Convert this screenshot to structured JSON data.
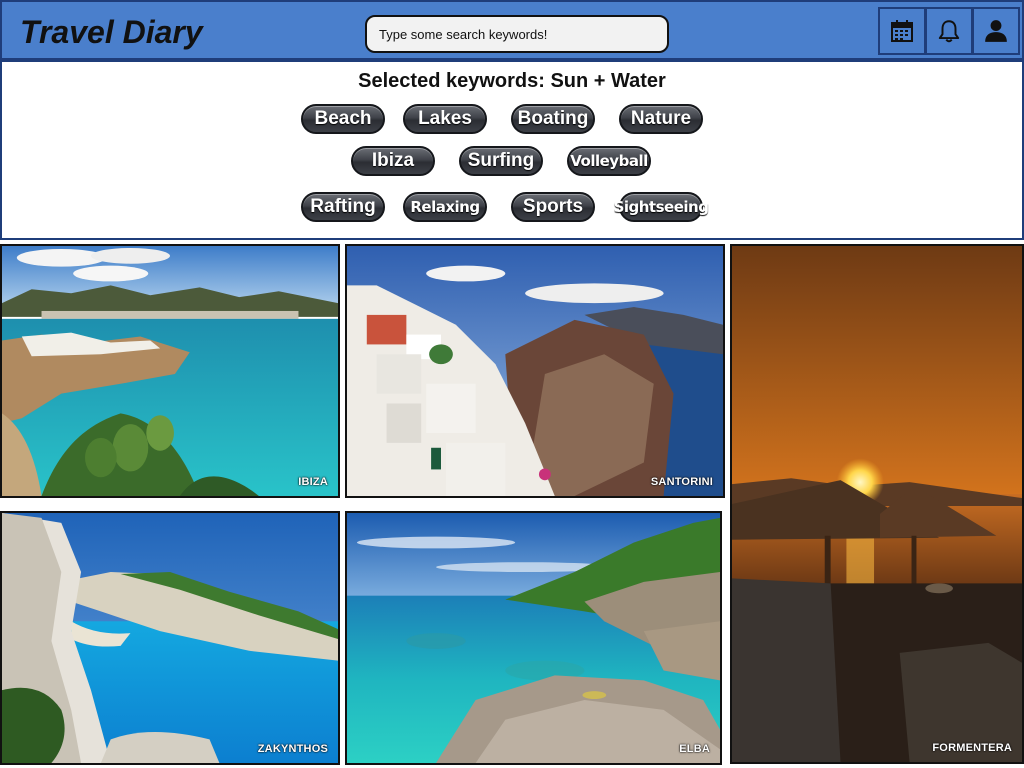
{
  "app": {
    "title": "Travel Diary"
  },
  "search": {
    "placeholder": "Type some search keywords!"
  },
  "header_icons": [
    "calendar-icon",
    "bell-icon",
    "user-icon"
  ],
  "keywords": {
    "heading": "Selected keywords: Sun + Water",
    "rows": [
      [
        "Beach",
        "Lakes",
        "Boating",
        "Nature"
      ],
      [
        "Ibiza",
        "Surfing",
        "Volleyball"
      ],
      [
        "Rafting",
        "Relaxing",
        "Sports",
        "Sightseeing"
      ]
    ]
  },
  "destinations": [
    {
      "name": "IBIZA"
    },
    {
      "name": "SANTORINI"
    },
    {
      "name": "FORMENTERA"
    },
    {
      "name": "ZAKYNTHOS"
    },
    {
      "name": "ELBA"
    }
  ],
  "colors": {
    "header": "#4a7fcc",
    "header_border": "#1f3d7a",
    "chip": "#3f4249"
  }
}
